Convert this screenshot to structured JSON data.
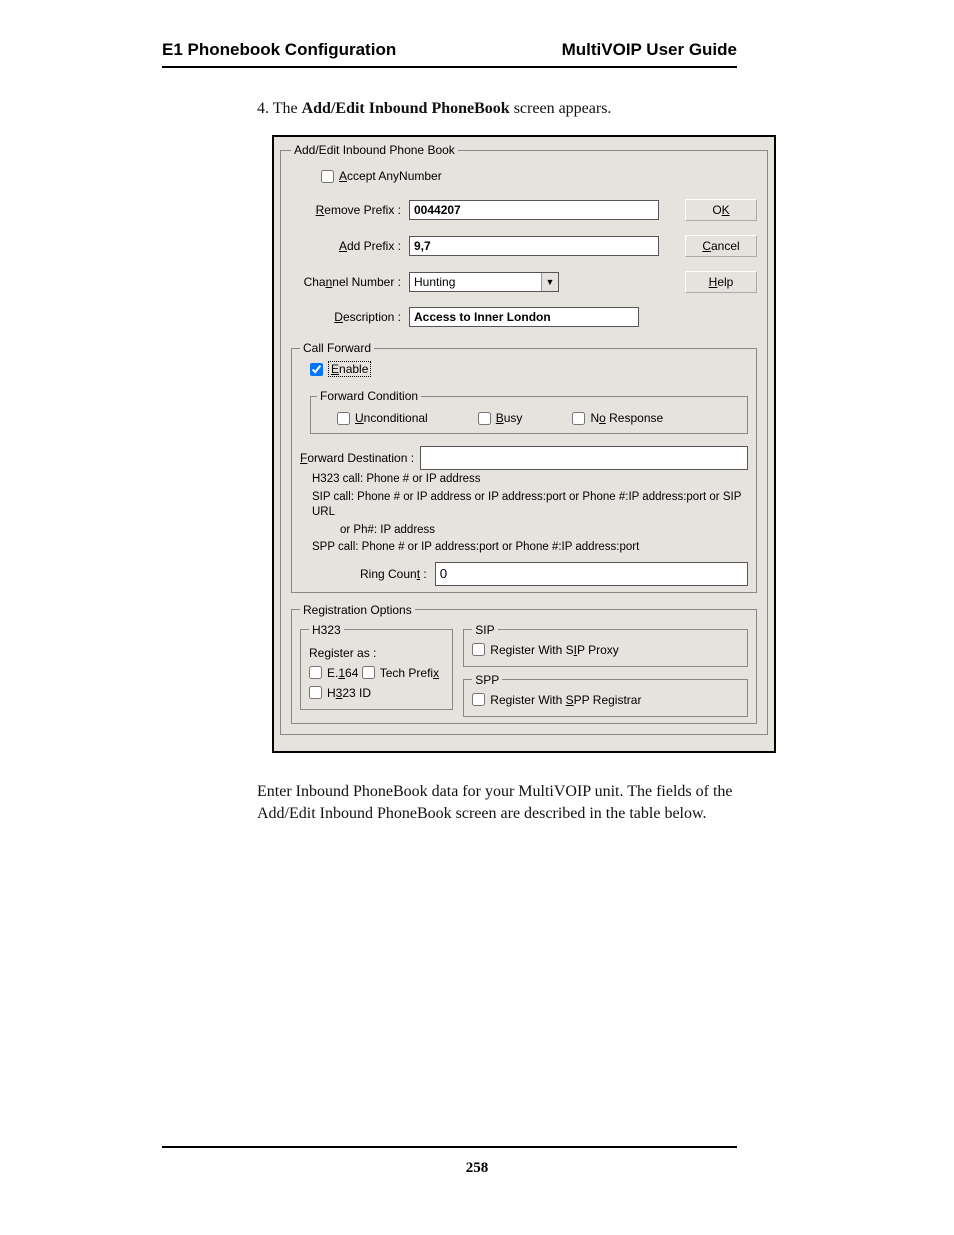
{
  "header": {
    "left": "E1 Phonebook Configuration",
    "right": "MultiVOIP User Guide"
  },
  "intro": {
    "prefix": "4. The ",
    "bold": "Add/Edit Inbound PhoneBook",
    "suffix": " screen appears."
  },
  "dialog": {
    "groupbox_title": "Add/Edit Inbound Phone Book",
    "accept_any": "Accept AnyNumber",
    "remove_prefix_label": "Remove Prefix :",
    "remove_prefix_value": "0044207",
    "add_prefix_label": "Add Prefix :",
    "add_prefix_value": "9,7",
    "channel_label": "Channel Number :",
    "channel_value": "Hunting",
    "description_label": "Description :",
    "description_value": "Access to Inner London",
    "ok": "OK",
    "cancel": "Cancel",
    "help": "Help",
    "call_forward": {
      "title": "Call Forward",
      "enable": "Enable",
      "forward_condition": "Forward Condition",
      "unconditional": "Unconditional",
      "busy": "Busy",
      "no_response": "No Response",
      "forward_dest_label": "Forward  Destination :",
      "hint1": "H323 call: Phone # or IP address",
      "hint2": "SIP call: Phone # or IP address or IP address:port or Phone #:IP address:port or SIP URL",
      "hint3": "or  Ph#: IP address",
      "hint4": "SPP call: Phone # or IP address:port or Phone #:IP address:port",
      "ring_count_label": "Ring Count :",
      "ring_count_value": "0"
    },
    "reg": {
      "title": "Registration Options",
      "h323": "H323",
      "register_as": "Register as :",
      "e164": "E.164",
      "tech_prefix": "Tech Prefix",
      "h323_id": "H323 ID",
      "sip": "SIP",
      "reg_sip": "Register With SIP Proxy",
      "spp": "SPP",
      "reg_spp": "Register With SPP Registrar"
    }
  },
  "outro": "Enter Inbound PhoneBook data for your MultiVOIP unit.  The fields of the Add/Edit Inbound PhoneBook screen are described in the table below.",
  "page_number": "258"
}
